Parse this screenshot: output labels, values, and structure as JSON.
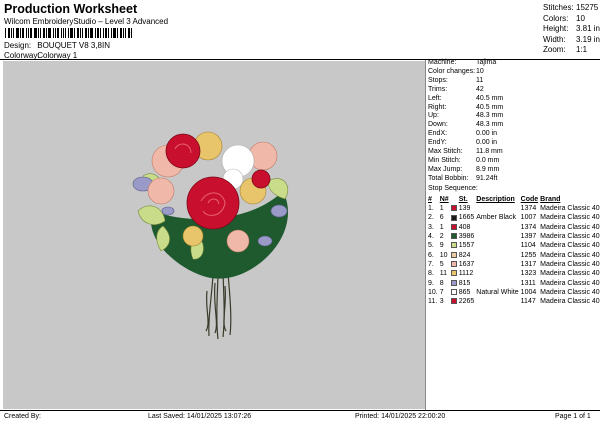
{
  "header": {
    "title": "Production Worksheet",
    "subtitle": "Wilcom EmbroideryStudio – Level 3 Advanced",
    "barcode_tail": ",",
    "design_label": "Design:",
    "design_value": "BOUQUET V8 3,8IN",
    "colorway_label": "Colorway:",
    "colorway_value": "Colorway 1"
  },
  "stats": {
    "stitches_label": "Stitches:",
    "stitches": "15275",
    "colors_label": "Colors:",
    "colors": "10",
    "height_label": "Height:",
    "height": "3.81 in",
    "width_label": "Width:",
    "width": "3.19 in",
    "zoom_label": "Zoom:",
    "zoom": "1:1"
  },
  "machine_info": [
    {
      "k": "Machine:",
      "v": "Tajima"
    },
    {
      "k": "Color changes:",
      "v": "10"
    },
    {
      "k": "Stops:",
      "v": "11"
    },
    {
      "k": "Trims:",
      "v": "42"
    },
    {
      "k": "Left:",
      "v": "40.5 mm"
    },
    {
      "k": "Right:",
      "v": "40.5 mm"
    },
    {
      "k": "Up:",
      "v": "48.3 mm"
    },
    {
      "k": "Down:",
      "v": "48.3 mm"
    },
    {
      "k": "EndX:",
      "v": "0.00 in"
    },
    {
      "k": "EndY:",
      "v": "0.00 in"
    },
    {
      "k": "Max Stitch:",
      "v": "11.8 mm"
    },
    {
      "k": "Min Stitch:",
      "v": "0.0 mm"
    },
    {
      "k": "Max Jump:",
      "v": "8.9 mm"
    },
    {
      "k": "Total Bobbin:",
      "v": "91.24ft"
    }
  ],
  "stop_sequence": {
    "title": "Stop Sequence:",
    "headers": [
      "#",
      "N#",
      "St.",
      "Description",
      "Code",
      "Brand"
    ],
    "rows": [
      {
        "n": "1.",
        "nn": "1",
        "color": "#c8102e",
        "st": "139",
        "desc": "",
        "code": "1374",
        "brand": "Madeira Classic 40"
      },
      {
        "n": "2.",
        "nn": "6",
        "color": "#1a1a1a",
        "st": "1665",
        "desc": "Amber Black",
        "code": "1007",
        "brand": "Madeira Classic 40"
      },
      {
        "n": "3.",
        "nn": "1",
        "color": "#c8102e",
        "st": "408",
        "desc": "",
        "code": "1374",
        "brand": "Madeira Classic 40"
      },
      {
        "n": "4.",
        "nn": "2",
        "color": "#1f5a2e",
        "st": "3986",
        "desc": "",
        "code": "1397",
        "brand": "Madeira Classic 40"
      },
      {
        "n": "5.",
        "nn": "9",
        "color": "#c9dc8a",
        "st": "1557",
        "desc": "",
        "code": "1104",
        "brand": "Madeira Classic 40"
      },
      {
        "n": "6.",
        "nn": "10",
        "color": "#e9c9a0",
        "st": "824",
        "desc": "",
        "code": "1255",
        "brand": "Madeira Classic 40"
      },
      {
        "n": "7.",
        "nn": "5",
        "color": "#f0b8a8",
        "st": "1637",
        "desc": "",
        "code": "1317",
        "brand": "Madeira Classic 40"
      },
      {
        "n": "8.",
        "nn": "11",
        "color": "#e8c46a",
        "st": "1112",
        "desc": "",
        "code": "1323",
        "brand": "Madeira Classic 40"
      },
      {
        "n": "9.",
        "nn": "8",
        "color": "#9a9ac8",
        "st": "815",
        "desc": "",
        "code": "1311",
        "brand": "Madeira Classic 40"
      },
      {
        "n": "10.",
        "nn": "7",
        "color": "#ffffff",
        "st": "865",
        "desc": "Natural White",
        "code": "1004",
        "brand": "Madeira Classic 40"
      },
      {
        "n": "11.",
        "nn": "3",
        "color": "#c8102e",
        "st": "2265",
        "desc": "",
        "code": "1147",
        "brand": "Madeira Classic 40"
      }
    ]
  },
  "footer": {
    "created": "Created By:",
    "saved": "Last Saved: 14/01/2025 13:07:26",
    "printed": "Printed: 14/01/2025 22:00:20",
    "page": "Page 1 of 1"
  }
}
